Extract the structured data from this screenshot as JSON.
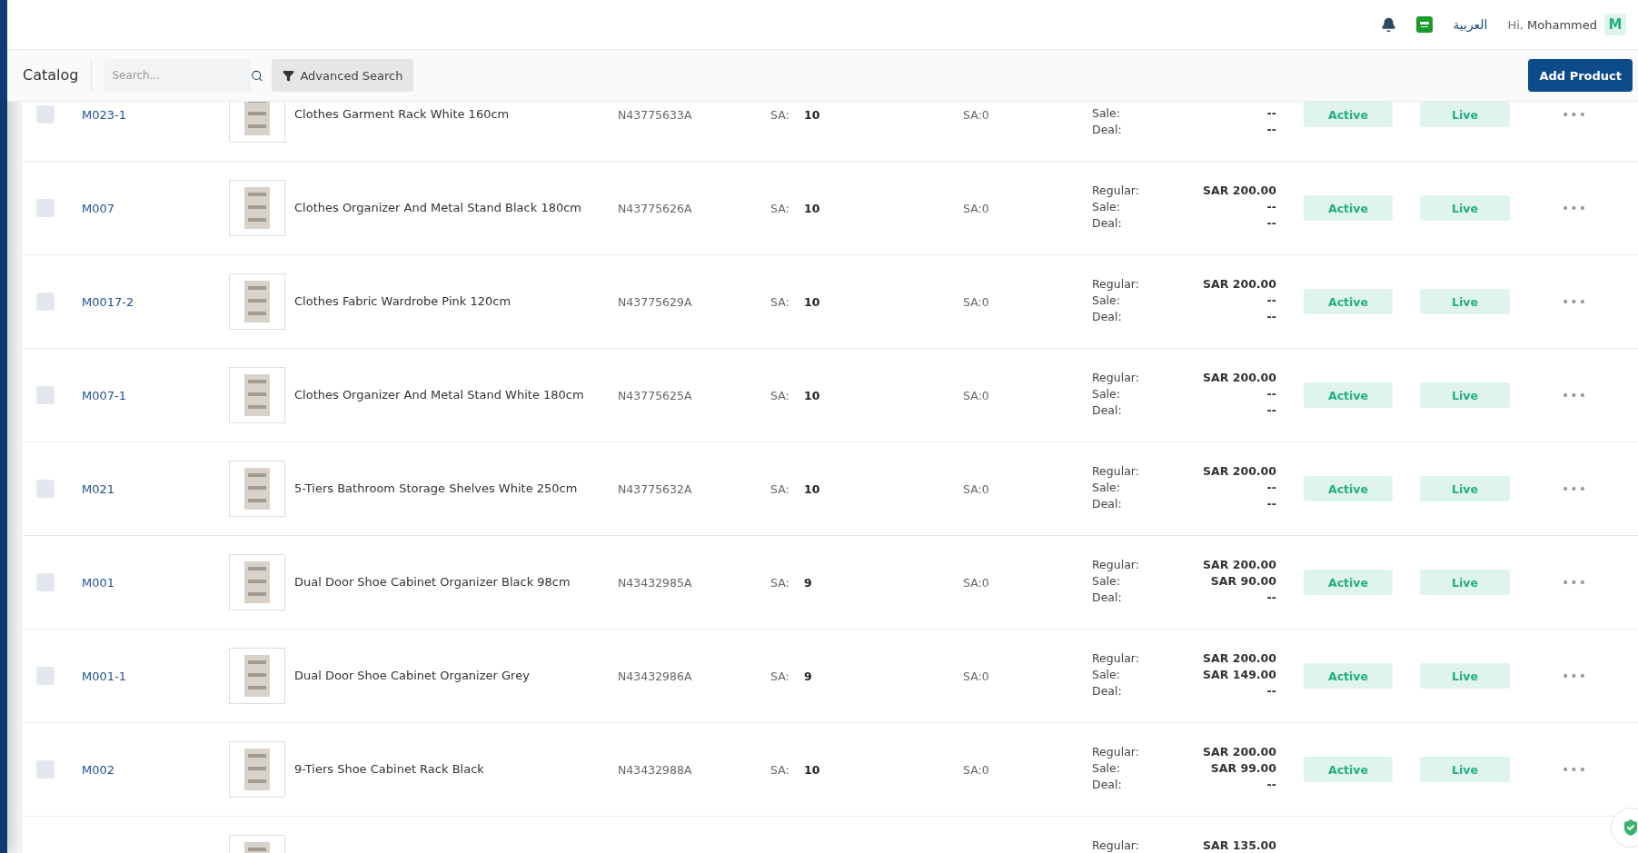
{
  "header": {
    "language": "العربية",
    "greeting": "Hi,",
    "user_name": "Mohammed",
    "avatar": "M"
  },
  "toolbar": {
    "title": "Catalog",
    "search": {
      "placeholder": "Search..."
    },
    "advanced_search": "Advanced Search",
    "add_button": "Add Product"
  },
  "rows": [
    {
      "checked": false,
      "sku": "M023-1",
      "name": "Clothes Garment Rack White 160cm",
      "barcode": "N43775633A",
      "stock_label": "SA:",
      "qty": "10",
      "warehouse": "SA:0",
      "prices": [
        {
          "kind": "sale",
          "label": "Sale:",
          "value": "--"
        },
        {
          "kind": "deal",
          "label": "Deal:",
          "value": "--"
        }
      ],
      "status": "Active",
      "visibility": "Live",
      "menu": "•••"
    },
    {
      "checked": false,
      "sku": "M007",
      "name": "Clothes Organizer And Metal Stand Black 180cm",
      "barcode": "N43775626A",
      "stock_label": "SA:",
      "qty": "10",
      "warehouse": "SA:0",
      "prices": [
        {
          "kind": "regular",
          "label": "Regular:",
          "value": "SAR 200.00"
        },
        {
          "kind": "sale",
          "label": "Sale:",
          "value": "--"
        },
        {
          "kind": "deal",
          "label": "Deal:",
          "value": "--"
        }
      ],
      "status": "Active",
      "visibility": "Live",
      "menu": "•••"
    },
    {
      "checked": false,
      "sku": "M0017-2",
      "name": "Clothes Fabric Wardrobe Pink 120cm",
      "barcode": "N43775629A",
      "stock_label": "SA:",
      "qty": "10",
      "warehouse": "SA:0",
      "prices": [
        {
          "kind": "regular",
          "label": "Regular:",
          "value": "SAR 200.00"
        },
        {
          "kind": "sale",
          "label": "Sale:",
          "value": "--"
        },
        {
          "kind": "deal",
          "label": "Deal:",
          "value": "--"
        }
      ],
      "status": "Active",
      "visibility": "Live",
      "menu": "•••"
    },
    {
      "checked": false,
      "sku": "M007-1",
      "name": "Clothes Organizer And Metal Stand White 180cm",
      "barcode": "N43775625A",
      "stock_label": "SA:",
      "qty": "10",
      "warehouse": "SA:0",
      "prices": [
        {
          "kind": "regular",
          "label": "Regular:",
          "value": "SAR 200.00"
        },
        {
          "kind": "sale",
          "label": "Sale:",
          "value": "--"
        },
        {
          "kind": "deal",
          "label": "Deal:",
          "value": "--"
        }
      ],
      "status": "Active",
      "visibility": "Live",
      "menu": "•••"
    },
    {
      "checked": false,
      "sku": "M021",
      "name": "5-Tiers Bathroom Storage Shelves White 250cm",
      "barcode": "N43775632A",
      "stock_label": "SA:",
      "qty": "10",
      "warehouse": "SA:0",
      "prices": [
        {
          "kind": "regular",
          "label": "Regular:",
          "value": "SAR 200.00"
        },
        {
          "kind": "sale",
          "label": "Sale:",
          "value": "--"
        },
        {
          "kind": "deal",
          "label": "Deal:",
          "value": "--"
        }
      ],
      "status": "Active",
      "visibility": "Live",
      "menu": "•••"
    },
    {
      "checked": false,
      "sku": "M001",
      "name": "Dual Door Shoe Cabinet Organizer Black 98cm",
      "barcode": "N43432985A",
      "stock_label": "SA:",
      "qty": "9",
      "warehouse": "SA:0",
      "prices": [
        {
          "kind": "regular",
          "label": "Regular:",
          "value": "SAR 200.00"
        },
        {
          "kind": "sale",
          "label": "Sale:",
          "value": "SAR 90.00"
        },
        {
          "kind": "deal",
          "label": "Deal:",
          "value": "--"
        }
      ],
      "status": "Active",
      "visibility": "Live",
      "menu": "•••"
    },
    {
      "checked": false,
      "sku": "M001-1",
      "name": "Dual Door Shoe Cabinet Organizer Grey",
      "barcode": "N43432986A",
      "stock_label": "SA:",
      "qty": "9",
      "warehouse": "SA:0",
      "prices": [
        {
          "kind": "regular",
          "label": "Regular:",
          "value": "SAR 200.00"
        },
        {
          "kind": "sale",
          "label": "Sale:",
          "value": "SAR 149.00"
        },
        {
          "kind": "deal",
          "label": "Deal:",
          "value": "--"
        }
      ],
      "status": "Active",
      "visibility": "Live",
      "menu": "•••"
    },
    {
      "checked": false,
      "sku": "M002",
      "name": "9-Tiers Shoe Cabinet Rack Black",
      "barcode": "N43432988A",
      "stock_label": "SA:",
      "qty": "10",
      "warehouse": "SA:0",
      "prices": [
        {
          "kind": "regular",
          "label": "Regular:",
          "value": "SAR 200.00"
        },
        {
          "kind": "sale",
          "label": "Sale:",
          "value": "SAR 99.00"
        },
        {
          "kind": "deal",
          "label": "Deal:",
          "value": "--"
        }
      ],
      "status": "Active",
      "visibility": "Live",
      "menu": "•••"
    },
    {
      "prices": [
        {
          "kind": "regular",
          "label": "Regular:",
          "value": "SAR 135.00"
        }
      ]
    }
  ]
}
